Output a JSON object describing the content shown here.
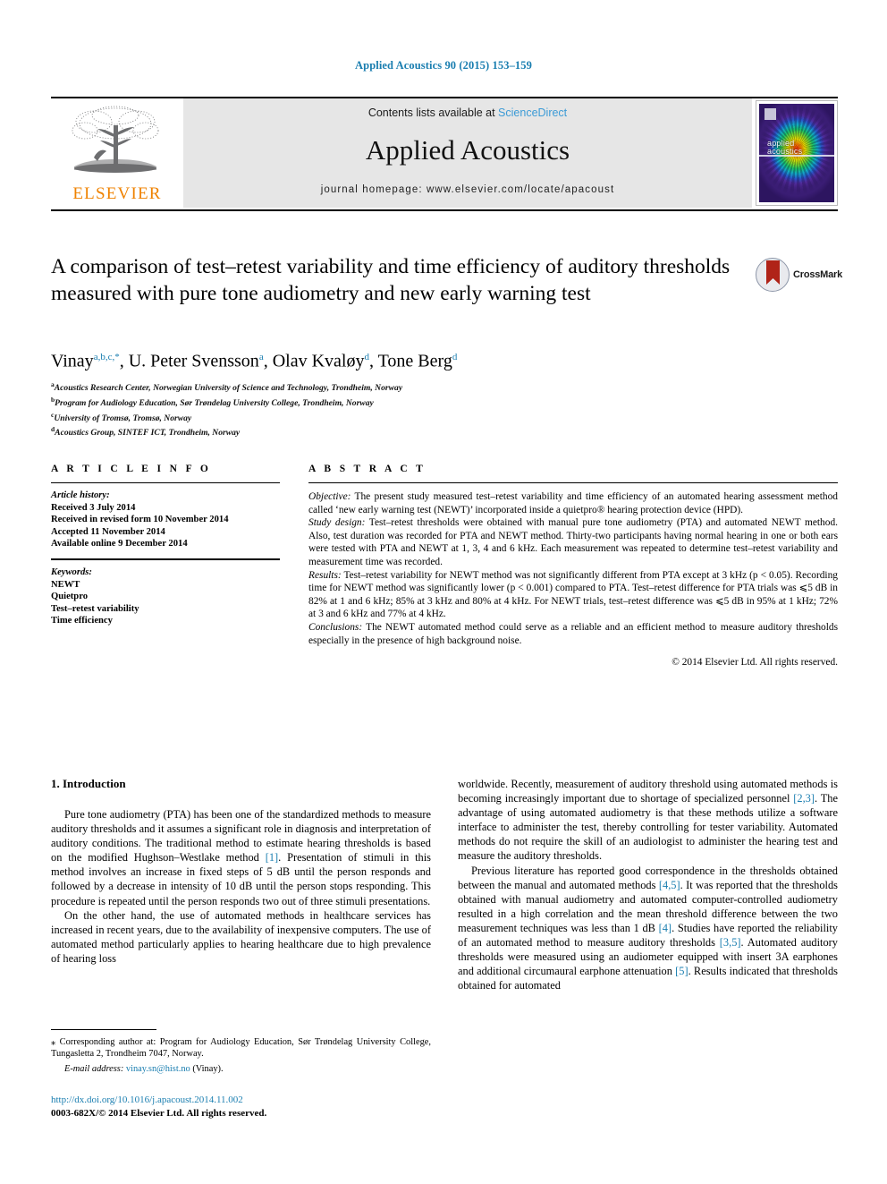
{
  "journal_ref": "Applied Acoustics 90 (2015) 153–159",
  "masthead": {
    "contents_prefix": "Contents lists available at ",
    "sciencedirect": "ScienceDirect",
    "journal_title": "Applied Acoustics",
    "homepage": "journal homepage: www.elsevier.com/locate/apacoust",
    "publisher_logo_text": "ELSEVIER",
    "cover_title_line1": "applied",
    "cover_title_line2": "acoustics"
  },
  "article": {
    "title": "A comparison of test–retest variability and time efficiency of auditory thresholds measured with pure tone audiometry and new early warning test",
    "crossmark_label": "CrossMark",
    "authors": [
      {
        "name": "Vinay",
        "sup": "a,b,c,*"
      },
      {
        "name": "U. Peter Svensson",
        "sup": "a"
      },
      {
        "name": "Olav Kvaløy",
        "sup": "d"
      },
      {
        "name": "Tone Berg",
        "sup": "d"
      }
    ],
    "affiliations": [
      {
        "mark": "a",
        "text": "Acoustics Research Center, Norwegian University of Science and Technology, Trondheim, Norway"
      },
      {
        "mark": "b",
        "text": "Program for Audiology Education, Sør Trøndelag University College, Trondheim, Norway"
      },
      {
        "mark": "c",
        "text": "University of Tromsø, Tromsø, Norway"
      },
      {
        "mark": "d",
        "text": "Acoustics Group, SINTEF ICT, Trondheim, Norway"
      }
    ]
  },
  "article_info": {
    "heading": "A R T I C L E   I N F O",
    "history_label": "Article history:",
    "history": [
      "Received 3 July 2014",
      "Received in revised form 10 November 2014",
      "Accepted 11 November 2014",
      "Available online 9 December 2014"
    ],
    "keywords_label": "Keywords:",
    "keywords": [
      "NEWT",
      "Quietpro",
      "Test–retest variability",
      "Time efficiency"
    ]
  },
  "abstract": {
    "heading": "A B S T R A C T",
    "objective_label": "Objective:",
    "objective_text": " The present study measured test–retest variability and time efficiency of an automated hearing assessment method called ‘new early warning test (NEWT)’ incorporated inside a quietpro® hearing protection device (HPD).",
    "design_label": "Study design:",
    "design_text": " Test–retest thresholds were obtained with manual pure tone audiometry (PTA) and automated NEWT method. Also, test duration was recorded for PTA and NEWT method. Thirty-two participants having normal hearing in one or both ears were tested with PTA and NEWT at 1, 3, 4 and 6 kHz. Each measurement was repeated to determine test–retest variability and measurement time was recorded.",
    "results_label": "Results:",
    "results_text": " Test–retest variability for NEWT method was not significantly different from PTA except at 3 kHz (p < 0.05). Recording time for NEWT method was significantly lower (p < 0.001) compared to PTA. Test–retest difference for PTA trials was ⩽5 dB in 82% at 1 and 6 kHz; 85% at 3 kHz and 80% at 4 kHz. For NEWT trials, test–retest difference was ⩽5 dB in 95% at 1 kHz; 72% at 3 and 6 kHz and 77% at 4 kHz.",
    "conclusions_label": "Conclusions:",
    "conclusions_text": " The NEWT automated method could serve as a reliable and an efficient method to measure auditory thresholds especially in the presence of high background noise.",
    "copyright": "© 2014 Elsevier Ltd. All rights reserved."
  },
  "introduction": {
    "heading": "1. Introduction",
    "left_paragraph_1_a": "Pure tone audiometry (PTA) has been one of the standardized methods to measure auditory thresholds and it assumes a significant role in diagnosis and interpretation of auditory conditions. The traditional method to estimate hearing thresholds is based on the modified Hughson–Westlake method ",
    "left_cite_1": "[1]",
    "left_paragraph_1_b": ". Presentation of stimuli in this method involves an increase in fixed steps of 5 dB until the person responds and followed by a decrease in intensity of 10 dB until the person stops responding. This procedure is repeated until the person responds two out of three stimuli presentations.",
    "left_paragraph_2": "On the other hand, the use of automated methods in healthcare services has increased in recent years, due to the availability of inexpensive computers. The use of automated method particularly applies to hearing healthcare due to high prevalence of hearing loss",
    "right_paragraph_1_a": "worldwide. Recently, measurement of auditory threshold using automated methods is becoming increasingly important due to shortage of specialized personnel ",
    "right_cite_1": "[2,3]",
    "right_paragraph_1_b": ". The advantage of using automated audiometry is that these methods utilize a software interface to administer the test, thereby controlling for tester variability. Automated methods do not require the skill of an audiologist to administer the hearing test and measure the auditory thresholds.",
    "right_paragraph_2_a": "Previous literature has reported good correspondence in the thresholds obtained between the manual and automated methods ",
    "right_cite_2": "[4,5]",
    "right_paragraph_2_b": ". It was reported that the thresholds obtained with manual audiometry and automated computer-controlled audiometry resulted in a high correlation and the mean threshold difference between the two measurement techniques was less than 1 dB ",
    "right_cite_3": "[4]",
    "right_paragraph_2_c": ". Studies have reported the reliability of an automated method to measure auditory thresholds ",
    "right_cite_4": "[3,5]",
    "right_paragraph_2_d": ". Automated auditory thresholds were measured using an audiometer equipped with insert 3A earphones and additional circumaural earphone attenuation ",
    "right_cite_5": "[5]",
    "right_paragraph_2_e": ". Results indicated that thresholds obtained for automated"
  },
  "footnote": {
    "corresponding_mark": "⁎",
    "corresponding_text": " Corresponding author at: Program for Audiology Education, Sør Trøndelag University College, Tungasletta 2, Trondheim 7047, Norway.",
    "email_label": "E-mail address:",
    "email": "vinay.sn@hist.no",
    "email_suffix": " (Vinay)."
  },
  "doi_block": {
    "doi": "http://dx.doi.org/10.1016/j.apacoust.2014.11.002",
    "issn": "0003-682X/© 2014 Elsevier Ltd. All rights reserved."
  },
  "colors": {
    "link_blue": "#1a7eb0",
    "sciencedirect_blue": "#3c9bd6",
    "elsevier_orange": "#ef8200",
    "crossmark_red": "#b02318",
    "band_gray": "#e6e6e6"
  }
}
